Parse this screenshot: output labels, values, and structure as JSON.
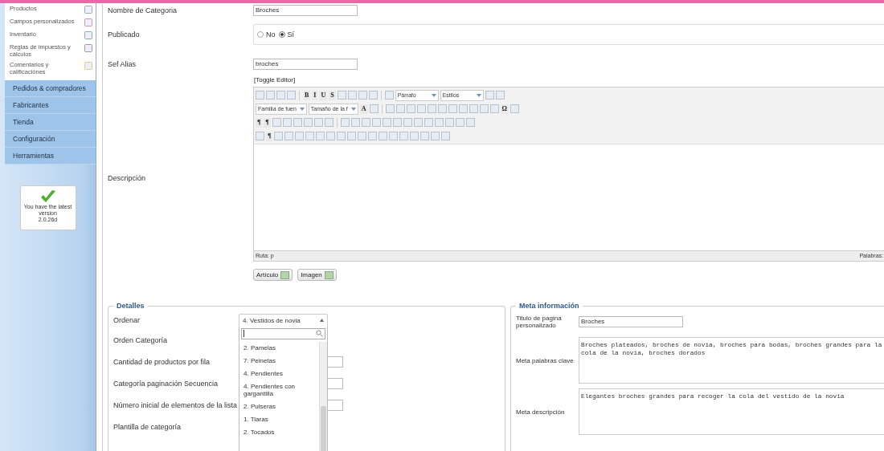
{
  "sidebar": {
    "items": [
      {
        "label": "Productos"
      },
      {
        "label": "Campos personalizados"
      },
      {
        "label": "Inventario"
      },
      {
        "label": "Reglas de impuestos y cálculos"
      },
      {
        "label": "Comentarios y calificaciónes"
      }
    ],
    "menu": [
      "Pedidos & compradores",
      "Fabricantes",
      "Tienda",
      "Configuración",
      "Herramientas"
    ],
    "version_box": {
      "lines": [
        "You have the latest",
        "version",
        "2.0.26d"
      ]
    }
  },
  "form": {
    "name": {
      "label": "Nombre de Categoria",
      "value": "Broches"
    },
    "published": {
      "label": "Publicado",
      "options": [
        {
          "label": "No",
          "selected": false
        },
        {
          "label": "Sí",
          "selected": true
        }
      ]
    },
    "alias": {
      "label": "Sef Alias",
      "value": "broches"
    },
    "description": {
      "label": "Descripción",
      "toggle": "[Toggle Editor]",
      "toolbar": [
        [
          {
            "kind": "icon"
          },
          {
            "kind": "icon"
          },
          {
            "kind": "icon"
          },
          {
            "kind": "icon"
          },
          {
            "kind": "sep"
          },
          {
            "kind": "text",
            "label": "B"
          },
          {
            "kind": "text",
            "label": "I"
          },
          {
            "kind": "text",
            "label": "U"
          },
          {
            "kind": "text",
            "label": "S"
          },
          {
            "kind": "icon"
          },
          {
            "kind": "icon"
          },
          {
            "kind": "icon"
          },
          {
            "kind": "icon"
          },
          {
            "kind": "sep"
          },
          {
            "kind": "icon"
          },
          {
            "kind": "select",
            "label": "Párrafo"
          },
          {
            "kind": "select",
            "label": "Estilos"
          },
          {
            "kind": "icon"
          },
          {
            "kind": "icon"
          }
        ],
        [
          {
            "kind": "select",
            "label": "Familia de fuen"
          },
          {
            "kind": "select",
            "label": "Tamaño de la f"
          },
          {
            "kind": "text",
            "label": "A"
          },
          {
            "kind": "icon"
          },
          {
            "kind": "sep"
          },
          {
            "kind": "icon"
          },
          {
            "kind": "icon"
          },
          {
            "kind": "icon"
          },
          {
            "kind": "icon"
          },
          {
            "kind": "icon"
          },
          {
            "kind": "icon"
          },
          {
            "kind": "icon"
          },
          {
            "kind": "icon"
          },
          {
            "kind": "icon"
          },
          {
            "kind": "icon"
          },
          {
            "kind": "icon"
          },
          {
            "kind": "text",
            "label": "Ω"
          },
          {
            "kind": "icon"
          }
        ],
        [
          {
            "kind": "text",
            "label": "¶"
          },
          {
            "kind": "text",
            "label": "¶"
          },
          {
            "kind": "icon"
          },
          {
            "kind": "icon"
          },
          {
            "kind": "icon"
          },
          {
            "kind": "icon"
          },
          {
            "kind": "icon"
          },
          {
            "kind": "icon"
          },
          {
            "kind": "sep"
          },
          {
            "kind": "icon"
          },
          {
            "kind": "icon"
          },
          {
            "kind": "icon"
          },
          {
            "kind": "icon"
          },
          {
            "kind": "icon"
          },
          {
            "kind": "icon"
          },
          {
            "kind": "icon"
          },
          {
            "kind": "icon"
          },
          {
            "kind": "icon"
          },
          {
            "kind": "icon"
          },
          {
            "kind": "icon"
          },
          {
            "kind": "icon"
          },
          {
            "kind": "icon"
          }
        ],
        [
          {
            "kind": "icon"
          },
          {
            "kind": "text",
            "label": "¶"
          },
          {
            "kind": "icon"
          },
          {
            "kind": "icon"
          },
          {
            "kind": "icon"
          },
          {
            "kind": "icon"
          },
          {
            "kind": "icon"
          },
          {
            "kind": "icon"
          },
          {
            "kind": "icon"
          },
          {
            "kind": "icon"
          },
          {
            "kind": "icon"
          },
          {
            "kind": "icon"
          },
          {
            "kind": "icon"
          },
          {
            "kind": "icon"
          },
          {
            "kind": "icon"
          },
          {
            "kind": "icon"
          },
          {
            "kind": "icon"
          },
          {
            "kind": "icon"
          },
          {
            "kind": "icon"
          }
        ]
      ],
      "path": "Ruta: p",
      "words": "Palabras:",
      "buttons": [
        "Artículo",
        "Imagen"
      ]
    }
  },
  "details": {
    "legend": "Detalles",
    "rows": [
      {
        "label": "Ordenar",
        "kind": "select",
        "value": "4. Vestidos de novia"
      },
      {
        "label": "Orden Categoría",
        "kind": "none"
      },
      {
        "label": "Cantidad de productos por fila",
        "kind": "input"
      },
      {
        "label": "Categoría paginación Secuencia",
        "kind": "input"
      },
      {
        "label": "Número inicial de elementos de la lista",
        "kind": "input"
      },
      {
        "label": "Plantilla de categoría",
        "kind": "none"
      }
    ],
    "dropdown": [
      "2. Pamelas",
      "7. Peinetas",
      "4. Pendientes",
      "4. Pendientes con gargantilla",
      "2. Pulseras",
      "1. Tiaras",
      "2. Tocados"
    ]
  },
  "meta": {
    "legend": "Meta información",
    "title": {
      "label": "Titulo de pagina personalizado",
      "value": "Broches"
    },
    "keywords": {
      "label": "Meta palabras clave",
      "value": "Broches plateados, broches de novia, broches para bodas, broches grandes para la\ncola de la novia, broches dorados"
    },
    "description": {
      "label": "Meta descripción",
      "value": "Elegantes broches grandes para recoger la cola del vestido de la novia"
    }
  }
}
